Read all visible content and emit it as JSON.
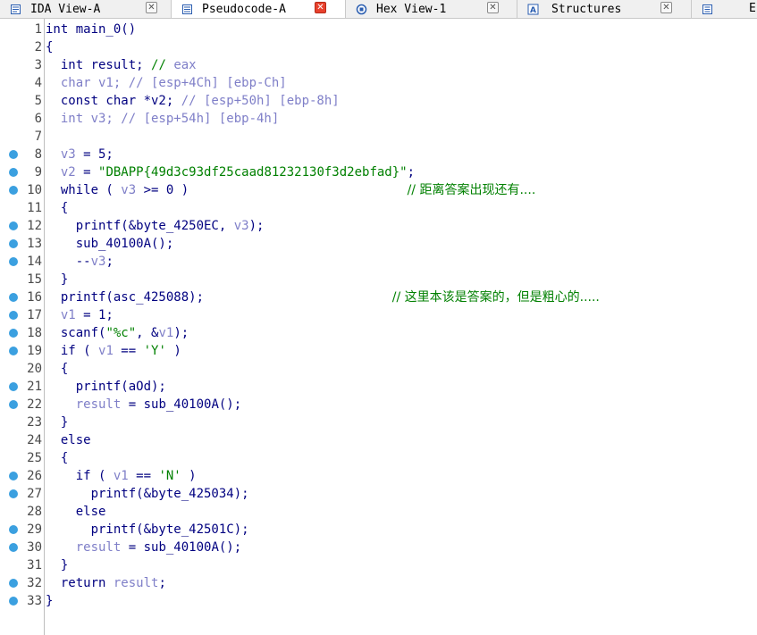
{
  "tabs": [
    {
      "label": "IDA View-A",
      "icon": "ida-view-icon",
      "active": false
    },
    {
      "label": "Pseudocode-A",
      "icon": "pseudocode-icon",
      "active": true
    },
    {
      "label": "Hex View-1",
      "icon": "hex-view-icon",
      "active": false
    },
    {
      "label": "Structures",
      "icon": "structures-icon",
      "active": false
    },
    {
      "label": "",
      "icon": "enums-icon",
      "active": false
    }
  ],
  "code_lines": [
    {
      "n": "1",
      "bp": false,
      "parts": [
        [
          "k",
          "int main_0()"
        ]
      ]
    },
    {
      "n": "2",
      "bp": false,
      "parts": [
        [
          "k",
          "{"
        ]
      ]
    },
    {
      "n": "3",
      "bp": false,
      "parts": [
        [
          "k",
          "  int result; "
        ],
        [
          "s",
          "// "
        ],
        [
          "v",
          "eax"
        ]
      ]
    },
    {
      "n": "4",
      "bp": false,
      "parts": [
        [
          "v",
          "  char v1; // [esp+4Ch] [ebp-Ch]"
        ]
      ]
    },
    {
      "n": "5",
      "bp": false,
      "parts": [
        [
          "k",
          "  const char *v2; "
        ],
        [
          "v",
          "// [esp+50h] [ebp-8h]"
        ]
      ]
    },
    {
      "n": "6",
      "bp": false,
      "parts": [
        [
          "v",
          "  int v3; // [esp+54h] [ebp-4h]"
        ]
      ]
    },
    {
      "n": "7",
      "bp": false,
      "parts": []
    },
    {
      "n": "8",
      "bp": true,
      "parts": [
        [
          "k",
          "  "
        ],
        [
          "v",
          "v3"
        ],
        [
          "k",
          " = 5;"
        ]
      ]
    },
    {
      "n": "9",
      "bp": true,
      "parts": [
        [
          "k",
          "  "
        ],
        [
          "v",
          "v2"
        ],
        [
          "k",
          " = "
        ],
        [
          "s",
          "\"DBAPP{49d3c93df25caad81232130f3d2ebfad}\""
        ],
        [
          "k",
          ";"
        ]
      ]
    },
    {
      "n": "10",
      "bp": true,
      "parts": [
        [
          "k",
          "  while ( "
        ],
        [
          "v",
          "v3"
        ],
        [
          "k",
          " >= 0 )                             "
        ],
        [
          "c",
          "// 距离答案出现还有...."
        ]
      ]
    },
    {
      "n": "11",
      "bp": false,
      "parts": [
        [
          "k",
          "  {"
        ]
      ]
    },
    {
      "n": "12",
      "bp": true,
      "parts": [
        [
          "k",
          "    printf(&byte_4250EC, "
        ],
        [
          "v",
          "v3"
        ],
        [
          "k",
          ");"
        ]
      ]
    },
    {
      "n": "13",
      "bp": true,
      "parts": [
        [
          "k",
          "    sub_40100A();"
        ]
      ]
    },
    {
      "n": "14",
      "bp": true,
      "parts": [
        [
          "k",
          "    --"
        ],
        [
          "v",
          "v3"
        ],
        [
          "k",
          ";"
        ]
      ]
    },
    {
      "n": "15",
      "bp": false,
      "parts": [
        [
          "k",
          "  }"
        ]
      ]
    },
    {
      "n": "16",
      "bp": true,
      "parts": [
        [
          "k",
          "  printf(asc_425088);                         "
        ],
        [
          "c",
          "// 这里本该是答案的，但是粗心的....."
        ]
      ]
    },
    {
      "n": "17",
      "bp": true,
      "parts": [
        [
          "k",
          "  "
        ],
        [
          "v",
          "v1"
        ],
        [
          "k",
          " = 1;"
        ]
      ]
    },
    {
      "n": "18",
      "bp": true,
      "parts": [
        [
          "k",
          "  scanf("
        ],
        [
          "s",
          "\"%c\""
        ],
        [
          "k",
          ", &"
        ],
        [
          "v",
          "v1"
        ],
        [
          "k",
          ");"
        ]
      ]
    },
    {
      "n": "19",
      "bp": true,
      "parts": [
        [
          "k",
          "  if ( "
        ],
        [
          "v",
          "v1"
        ],
        [
          "k",
          " == "
        ],
        [
          "s",
          "'Y'"
        ],
        [
          "k",
          " )"
        ]
      ]
    },
    {
      "n": "20",
      "bp": false,
      "parts": [
        [
          "k",
          "  {"
        ]
      ]
    },
    {
      "n": "21",
      "bp": true,
      "parts": [
        [
          "k",
          "    printf(aOd);"
        ]
      ]
    },
    {
      "n": "22",
      "bp": true,
      "parts": [
        [
          "v",
          "    result"
        ],
        [
          "k",
          " = sub_40100A();"
        ]
      ]
    },
    {
      "n": "23",
      "bp": false,
      "parts": [
        [
          "k",
          "  }"
        ]
      ]
    },
    {
      "n": "24",
      "bp": false,
      "parts": [
        [
          "k",
          "  else"
        ]
      ]
    },
    {
      "n": "25",
      "bp": false,
      "parts": [
        [
          "k",
          "  {"
        ]
      ]
    },
    {
      "n": "26",
      "bp": true,
      "parts": [
        [
          "k",
          "    if ( "
        ],
        [
          "v",
          "v1"
        ],
        [
          "k",
          " == "
        ],
        [
          "s",
          "'N'"
        ],
        [
          "k",
          " )"
        ]
      ]
    },
    {
      "n": "27",
      "bp": true,
      "parts": [
        [
          "k",
          "      printf(&byte_425034);"
        ]
      ]
    },
    {
      "n": "28",
      "bp": false,
      "parts": [
        [
          "k",
          "    else"
        ]
      ]
    },
    {
      "n": "29",
      "bp": true,
      "parts": [
        [
          "k",
          "      printf(&byte_42501C);"
        ]
      ]
    },
    {
      "n": "30",
      "bp": true,
      "parts": [
        [
          "v",
          "    result"
        ],
        [
          "k",
          " = sub_40100A();"
        ]
      ]
    },
    {
      "n": "31",
      "bp": false,
      "parts": [
        [
          "k",
          "  }"
        ]
      ]
    },
    {
      "n": "32",
      "bp": true,
      "parts": [
        [
          "k",
          "  return "
        ],
        [
          "v",
          "result"
        ],
        [
          "k",
          ";"
        ]
      ]
    },
    {
      "n": "33",
      "bp": true,
      "parts": [
        [
          "k",
          "}"
        ]
      ]
    }
  ],
  "colors": {
    "keyword": "#000080",
    "variable": "#7f7fc8",
    "string": "#008000",
    "comment": "#008000",
    "breakpoint": "#3ba0e0",
    "active_close": "#e8412d"
  }
}
